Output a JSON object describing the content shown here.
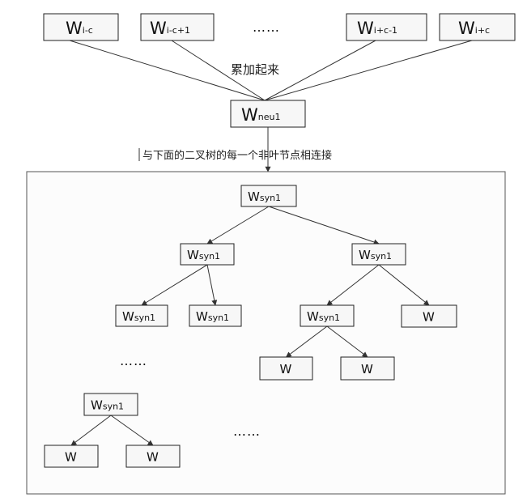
{
  "input_nodes": [
    {
      "main": "W",
      "sub": "i-c"
    },
    {
      "main": "W",
      "sub": "i-c+1"
    },
    {
      "main": "W",
      "sub": "i+c-1"
    },
    {
      "main": "W",
      "sub": "i+c"
    }
  ],
  "top_ellipsis": "……",
  "sum_label": "累加起来",
  "hidden_node": {
    "main": "W",
    "sub": "neu1"
  },
  "connect_label": "与下面的二叉树的每一个非叶节点相连接",
  "tree": {
    "nodes": [
      {
        "id": "root",
        "main": "W",
        "sub": "syn1"
      },
      {
        "id": "l",
        "main": "W",
        "sub": "syn1"
      },
      {
        "id": "r",
        "main": "W",
        "sub": "syn1"
      },
      {
        "id": "ll",
        "main": "W",
        "sub": "syn1"
      },
      {
        "id": "lr",
        "main": "W",
        "sub": "syn1"
      },
      {
        "id": "rl",
        "main": "W",
        "sub": "syn1"
      },
      {
        "id": "rr",
        "main": "W",
        "sub": ""
      },
      {
        "id": "rll",
        "main": "W",
        "sub": ""
      },
      {
        "id": "rlr",
        "main": "W",
        "sub": ""
      },
      {
        "id": "b",
        "main": "W",
        "sub": "syn1"
      },
      {
        "id": "bl",
        "main": "W",
        "sub": ""
      },
      {
        "id": "br",
        "main": "W",
        "sub": ""
      }
    ],
    "edges": [
      [
        "root",
        "l"
      ],
      [
        "root",
        "r"
      ],
      [
        "l",
        "ll"
      ],
      [
        "l",
        "lr"
      ],
      [
        "r",
        "rl"
      ],
      [
        "r",
        "rr"
      ],
      [
        "rl",
        "rll"
      ],
      [
        "rl",
        "rlr"
      ],
      [
        "b",
        "bl"
      ],
      [
        "b",
        "br"
      ]
    ],
    "ellipses": [
      "……",
      "……"
    ]
  }
}
